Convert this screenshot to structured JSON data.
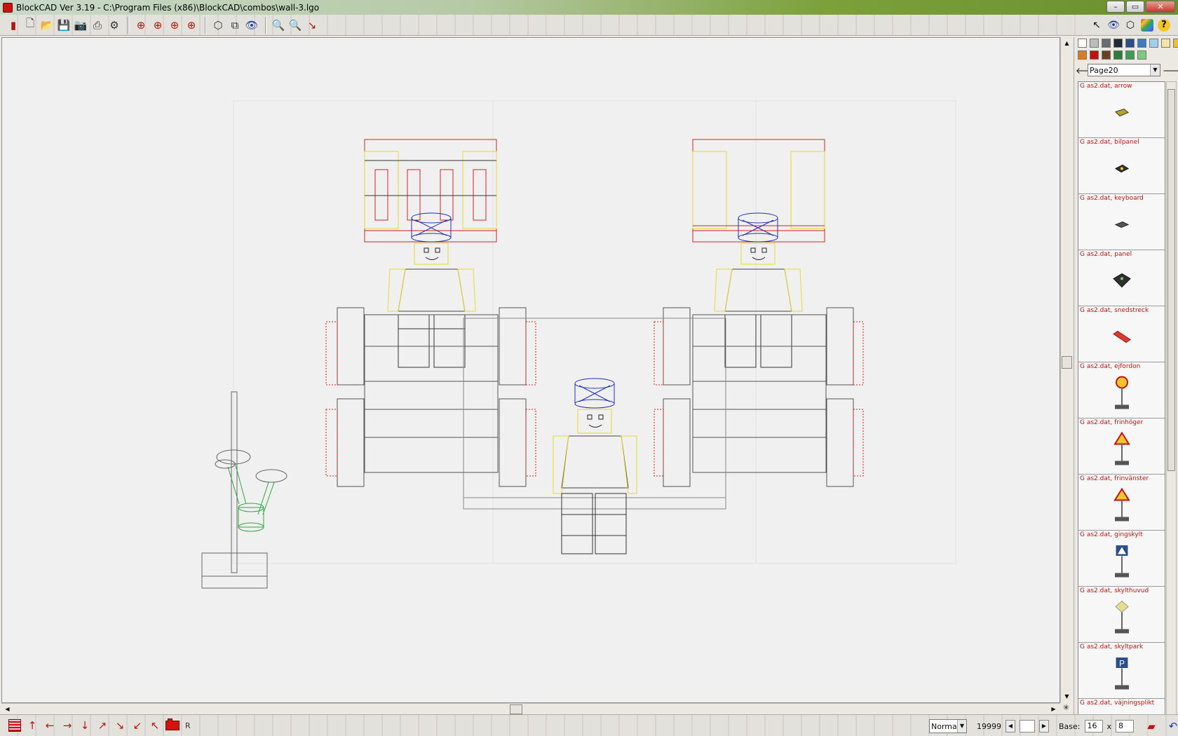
{
  "window": {
    "title": "BlockCAD Ver 3.19 - C:\\Program Files (x86)\\BlockCAD\\combos\\wall-3.lgo",
    "minimize": "–",
    "maximize": "▭",
    "close": "✕"
  },
  "toolbar": {
    "icons": [
      "blockcad-logo-icon",
      "new-file-icon",
      "open-folder-icon",
      "save-icon",
      "camera-icon",
      "print-icon",
      "settings-gear-icon",
      "rotate-left-icon",
      "rotate-up-icon",
      "rotate-down-icon",
      "rotate-right-icon",
      "view-flat-icon",
      "view-3d-icon",
      "eye-icon",
      "zoom-in-icon",
      "zoom-out-icon",
      "tool-icon"
    ]
  },
  "right_toolbar": {
    "icons": [
      "pointer-icon",
      "eye-icon",
      "layer-icon",
      "color-rainbow-icon",
      "help-icon"
    ],
    "help_label": "?"
  },
  "palette": {
    "colors": [
      "#ffffff",
      "#b9bcbd",
      "#6b6e70",
      "#1f2a36",
      "#2b4e8c",
      "#3d7cc2",
      "#9fd0ec",
      "#f7e3a3",
      "#f0c12e",
      "#e07b1d",
      "#c21210",
      "#6b4023",
      "#2b7d3c",
      "#3e9c55",
      "#7cc97f"
    ]
  },
  "part_browser": {
    "page_select": "Page20",
    "parts": [
      {
        "label": "G as2.dat, arrow"
      },
      {
        "label": "G as2.dat, bilpanel"
      },
      {
        "label": "G as2.dat, keyboard"
      },
      {
        "label": "G as2.dat, panel"
      },
      {
        "label": "G as2.dat, snedstreck"
      },
      {
        "label": "G as2.dat, ejfordon"
      },
      {
        "label": "G as2.dat, frinhöger"
      },
      {
        "label": "G as2.dat, frinvänster"
      },
      {
        "label": "G as2.dat, gingskylt"
      },
      {
        "label": "G as2.dat, skylthuvud"
      },
      {
        "label": "G as2.dat, skyltpark"
      },
      {
        "label": "G as2.dat, väjningsplikt"
      }
    ]
  },
  "statusbar": {
    "icons": [
      "grid-icon",
      "arrow-up-icon",
      "arrow-left-icon",
      "arrow-right-icon",
      "arrow-down-icon",
      "arrow-ne-icon",
      "arrow-se-icon",
      "arrow-sw-icon",
      "arrow-nw-icon",
      "brick-icon"
    ],
    "r_label": "R",
    "mode_select": "Norma",
    "count": "19999",
    "base_label": "Base:",
    "base_width": "16",
    "x_label": "x",
    "base_depth": "8"
  }
}
